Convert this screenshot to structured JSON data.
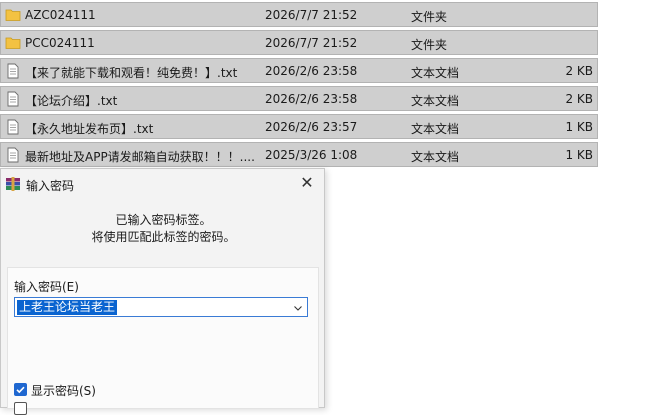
{
  "files": [
    {
      "icon": "folder-icon",
      "name": "AZC024111",
      "date": "2026/7/7 21:52",
      "type": "文件夹",
      "size": ""
    },
    {
      "icon": "folder-icon",
      "name": "PCC024111",
      "date": "2026/7/7 21:52",
      "type": "文件夹",
      "size": ""
    },
    {
      "icon": "text-file-icon",
      "name": "【来了就能下载和观看！纯免费！】.txt",
      "date": "2026/2/6 23:58",
      "type": "文本文档",
      "size": "2 KB"
    },
    {
      "icon": "text-file-icon",
      "name": "【论坛介绍】.txt",
      "date": "2026/2/6 23:58",
      "type": "文本文档",
      "size": "2 KB"
    },
    {
      "icon": "text-file-icon",
      "name": "【永久地址发布页】.txt",
      "date": "2026/2/6 23:57",
      "type": "文本文档",
      "size": "1 KB"
    },
    {
      "icon": "text-file-icon",
      "name": "最新地址及APP请发邮箱自动获取！！！....",
      "date": "2025/3/26 1:08",
      "type": "文本文档",
      "size": "1 KB"
    }
  ],
  "dialog": {
    "title": "输入密码",
    "message_line1": "已输入密码标签。",
    "message_line2": "将使用匹配此标签的密码。",
    "password_label": "输入密码(E)",
    "password_value": "上老王论坛当老王",
    "show_password_label": "显示密码(S)",
    "show_password_checked": true,
    "close_symbol": "✕"
  },
  "colors": {
    "row_bg": "#cfcfcf",
    "folder": "#f3c242",
    "selection": "#0a64d0",
    "checkbox": "#1f67d0"
  }
}
